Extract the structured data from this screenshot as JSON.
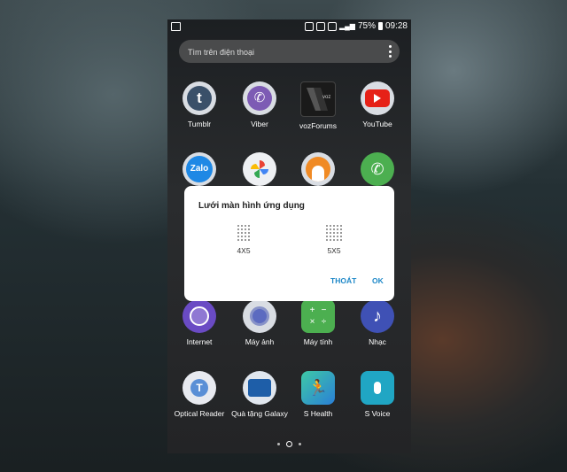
{
  "status_bar": {
    "battery": "75%",
    "time": "09:28"
  },
  "search": {
    "placeholder": "Tìm trên điện thoại"
  },
  "apps": [
    {
      "label": "Tumblr",
      "icon": "tumblr-icon",
      "color": "#3a5069"
    },
    {
      "label": "Viber",
      "icon": "viber-icon",
      "color": "#7d5bb4"
    },
    {
      "label": "vozForums",
      "icon": "vozforums-icon",
      "color": "#1a1a1a"
    },
    {
      "label": "YouTube",
      "icon": "youtube-icon",
      "color": "#e62117"
    },
    {
      "label": "Zalo",
      "icon": "zalo-icon",
      "color": "#1e88e5"
    },
    {
      "label": "Photos",
      "icon": "photos-icon",
      "color": "#ffffff"
    },
    {
      "label": "Contacts",
      "icon": "contacts-icon",
      "color": "#f08a24"
    },
    {
      "label": "Phone",
      "icon": "phone-icon",
      "color": "#4caf50"
    },
    {
      "label": "Internet",
      "icon": "internet-icon",
      "color": "#6a4bc4"
    },
    {
      "label": "Máy ảnh",
      "icon": "camera-icon",
      "color": "#5c6bc0"
    },
    {
      "label": "Máy tính",
      "icon": "calculator-icon",
      "color": "#4caf50"
    },
    {
      "label": "Nhạc",
      "icon": "music-icon",
      "color": "#3f51b5"
    },
    {
      "label": "Optical Reader",
      "icon": "optical-reader-icon",
      "color": "#e8eaf0"
    },
    {
      "label": "Quà tặng Galaxy",
      "icon": "galaxy-gift-icon",
      "color": "#e0e6ee"
    },
    {
      "label": "S Health",
      "icon": "s-health-icon",
      "color": "#2aa6a0"
    },
    {
      "label": "S Voice",
      "icon": "s-voice-icon",
      "color": "#20a6c4"
    }
  ],
  "dialog": {
    "title": "Lưới màn hình ứng dụng",
    "option_4x5": "4X5",
    "option_5x5": "5X5",
    "cancel": "THOÁT",
    "ok": "OK"
  },
  "accent": "#1e88c8"
}
